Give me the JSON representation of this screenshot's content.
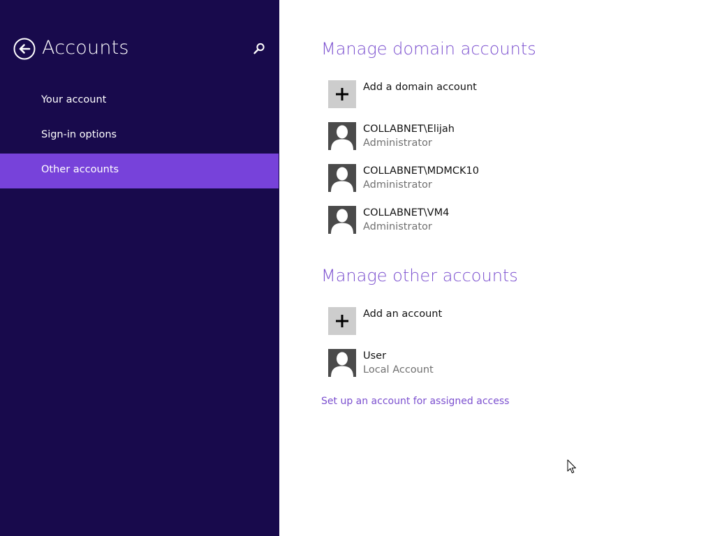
{
  "sidebar": {
    "title": "Accounts",
    "items": [
      {
        "label": "Your account"
      },
      {
        "label": "Sign-in options"
      },
      {
        "label": "Other accounts",
        "selected": true
      }
    ]
  },
  "domain_section": {
    "title": "Manage domain accounts",
    "add_label": "Add a domain account",
    "accounts": [
      {
        "name": "COLLABNET\\Elijah",
        "role": "Administrator"
      },
      {
        "name": "COLLABNET\\MDMCK10",
        "role": "Administrator"
      },
      {
        "name": "COLLABNET\\VM4",
        "role": "Administrator"
      }
    ]
  },
  "other_section": {
    "title": "Manage other accounts",
    "add_label": "Add an account",
    "accounts": [
      {
        "name": "User",
        "role": "Local Account"
      }
    ]
  },
  "assigned_access_link": "Set up an account for assigned access",
  "colors": {
    "sidebar_bg": "#180a4c",
    "selected_bg": "#7742da",
    "accent": "#7b4fcf"
  },
  "icons": [
    "back-arrow-icon",
    "search-icon",
    "plus-icon",
    "user-avatar-icon",
    "mouse-cursor-icon"
  ]
}
